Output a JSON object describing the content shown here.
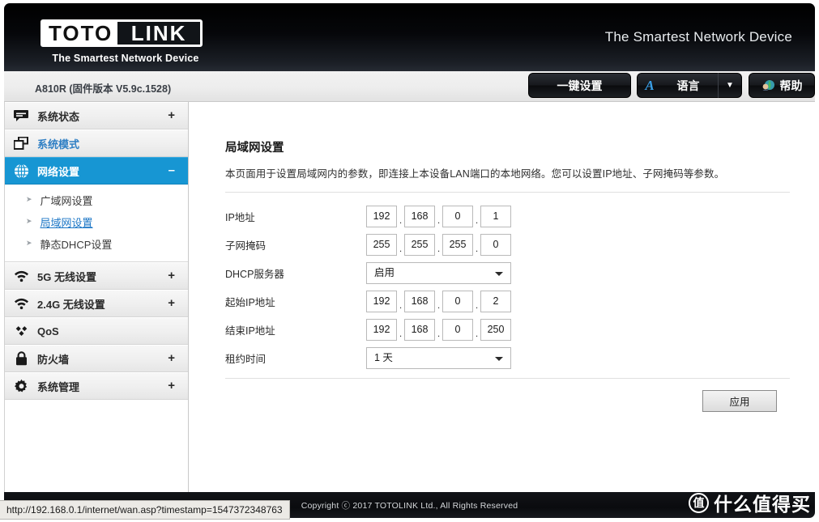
{
  "banner": {
    "logo_left": "TOTO",
    "logo_right": "LINK",
    "logo_tagline": "The Smartest Network Device",
    "right_tagline": "The Smartest Network Device"
  },
  "toolbar": {
    "device_info": "A810R (固件版本 V5.9c.1528)",
    "quick_setup_label": "一键设置",
    "language_icon_label": "A",
    "language_label": "语言",
    "language_caret": "▼",
    "help_label": "帮助"
  },
  "sidebar": {
    "items": [
      {
        "label": "系统状态",
        "icon": "chat-bubble-icon",
        "expander": "+",
        "state": "normal"
      },
      {
        "label": "系统模式",
        "icon": "windows-stack-icon",
        "expander": "",
        "state": "link"
      },
      {
        "label": "网络设置",
        "icon": "globe-grid-icon",
        "expander": "–",
        "state": "active"
      },
      {
        "label": "5G 无线设置",
        "icon": "wifi-icon",
        "expander": "+",
        "state": "normal"
      },
      {
        "label": "2.4G 无线设置",
        "icon": "wifi-icon",
        "expander": "+",
        "state": "normal"
      },
      {
        "label": "QoS",
        "icon": "diamond-cluster-icon",
        "expander": "",
        "state": "normal"
      },
      {
        "label": "防火墙",
        "icon": "lock-icon",
        "expander": "+",
        "state": "normal"
      },
      {
        "label": "系统管理",
        "icon": "gear-icon",
        "expander": "+",
        "state": "normal"
      }
    ],
    "subitems": [
      {
        "label": "广域网设置",
        "current": false
      },
      {
        "label": "局域网设置",
        "current": true
      },
      {
        "label": "静态DHCP设置",
        "current": false
      }
    ]
  },
  "content": {
    "title": "局域网设置",
    "description": "本页面用于设置局域网内的参数，即连接上本设备LAN端口的本地网络。您可以设置IP地址、子网掩码等参数。",
    "fields": {
      "ip_label": "IP地址",
      "ip_octets": [
        "192",
        "168",
        "0",
        "1"
      ],
      "mask_label": "子网掩码",
      "mask_octets": [
        "255",
        "255",
        "255",
        "0"
      ],
      "dhcp_label": "DHCP服务器",
      "dhcp_value": "启用",
      "start_label": "起始IP地址",
      "start_octets": [
        "192",
        "168",
        "0",
        "2"
      ],
      "end_label": "结束IP地址",
      "end_octets": [
        "192",
        "168",
        "0",
        "250"
      ],
      "lease_label": "租约时间",
      "lease_value": "1 天"
    },
    "apply_label": "应用"
  },
  "footer": {
    "copyright": "Copyright ⓒ 2017 TOTOLINK Ltd.,  All Rights Reserved"
  },
  "status_bar": {
    "url": "http://192.168.0.1/internet/wan.asp?timestamp=1547372348763"
  },
  "watermark": {
    "badge": "值",
    "text": "什么值得买"
  },
  "colors": {
    "accent": "#1796d3",
    "link": "#1b76c6",
    "banner": "#000000",
    "lang_icon": "#3aa0e8"
  }
}
